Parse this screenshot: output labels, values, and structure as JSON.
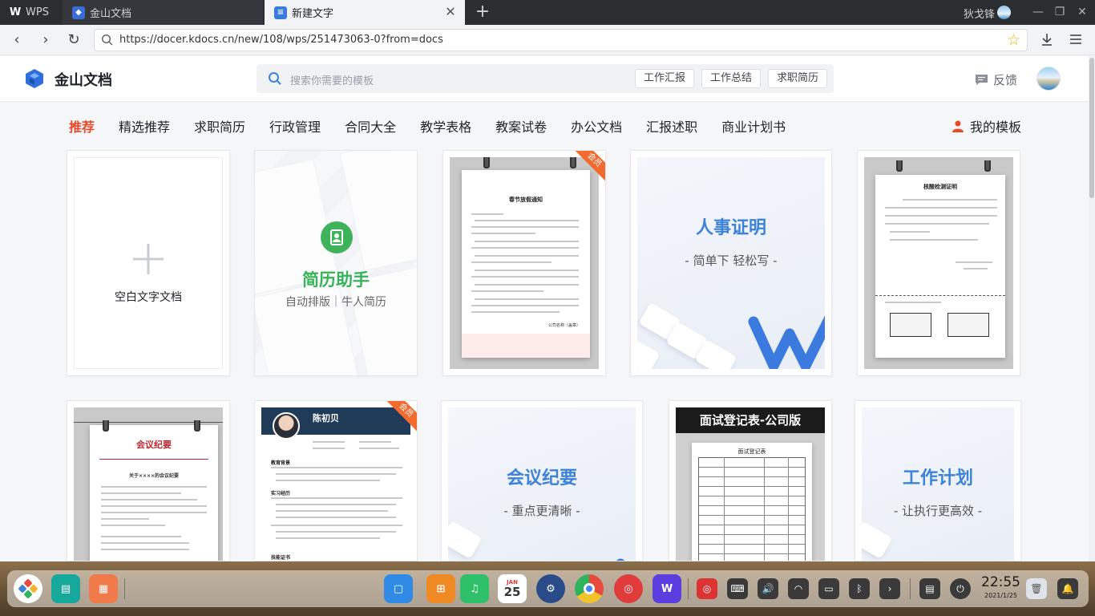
{
  "browser": {
    "tabs": [
      {
        "label": "WPS",
        "icon": "wps-logo-icon"
      },
      {
        "label": "金山文档",
        "icon": "kdocs-icon"
      },
      {
        "label": "新建文字",
        "icon": "document-icon",
        "active": true
      }
    ],
    "user_name": "狄戈锋",
    "url": "https://docer.kdocs.cn/new/108/wps/251473063-0?from=docs"
  },
  "header": {
    "logo_text": "金山文档",
    "search_placeholder": "搜索你需要的模板",
    "hot_tags": [
      "工作汇报",
      "工作总结",
      "求职简历"
    ],
    "feedback_label": "反馈"
  },
  "categories": [
    "推荐",
    "精选推荐",
    "求职简历",
    "行政管理",
    "合同大全",
    "教学表格",
    "教案试卷",
    "办公文档",
    "汇报述职",
    "商业计划书"
  ],
  "my_templates_label": "我的模板",
  "cards": {
    "blank": {
      "label": "空白文字文档"
    },
    "resume_helper": {
      "title": "简历助手",
      "subtitle": "自动排版｜牛人简历"
    },
    "spring_notice": {
      "title": "春节放假通知",
      "badge": "会员",
      "sign": "公司名称（盖章）"
    },
    "personnel_cert": {
      "title": "人事证明",
      "subtitle": "- 简单下 轻松写 -"
    },
    "nucleic_cert": {
      "title": "核酸检测证明"
    },
    "meeting_doc": {
      "title": "会议纪要",
      "subtitle": "关于××××的会议纪要"
    },
    "resume_vip": {
      "name": "陈初贝",
      "badge": "会员",
      "sections": [
        "教育背景",
        "实习经历",
        "技能证书"
      ]
    },
    "meeting_card": {
      "title": "会议纪要",
      "subtitle": "- 重点更清晰 -"
    },
    "interview_form": {
      "banner": "面试登记表-公司版",
      "form_title": "面试登记表"
    },
    "work_plan": {
      "title": "工作计划",
      "subtitle": "- 让执行更高效 -"
    }
  },
  "dock": {
    "calendar_month": "JAN",
    "calendar_day": "25",
    "time": "22:55",
    "date": "2021/1/25"
  },
  "colors": {
    "accent_red": "#e8492a",
    "brand_blue": "#3b82d8",
    "resume_green": "#36b258",
    "vip_orange": "#f26a2e"
  }
}
